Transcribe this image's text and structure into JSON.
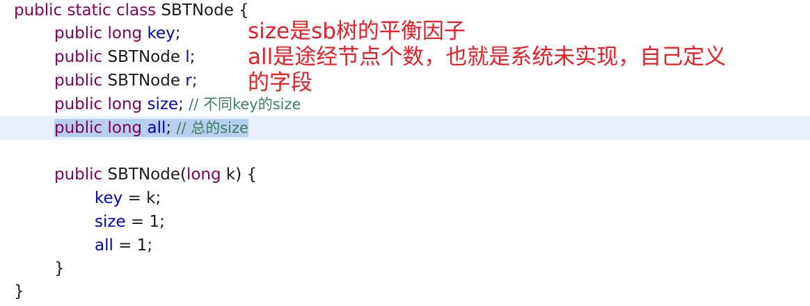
{
  "code": {
    "lines": [
      {
        "indent": 0,
        "tokens": [
          {
            "t": "public static class ",
            "c": "kw"
          },
          {
            "t": "SBTNode {",
            "c": "pl"
          }
        ]
      },
      {
        "indent": 1,
        "tokens": [
          {
            "t": "public long ",
            "c": "kw"
          },
          {
            "t": "key",
            "c": "fld"
          },
          {
            "t": ";",
            "c": "pl"
          }
        ]
      },
      {
        "indent": 1,
        "tokens": [
          {
            "t": "public ",
            "c": "kw"
          },
          {
            "t": "SBTNode ",
            "c": "pl"
          },
          {
            "t": "l",
            "c": "fld"
          },
          {
            "t": ";",
            "c": "pl"
          }
        ]
      },
      {
        "indent": 1,
        "tokens": [
          {
            "t": "public ",
            "c": "kw"
          },
          {
            "t": "SBTNode ",
            "c": "pl"
          },
          {
            "t": "r",
            "c": "fld"
          },
          {
            "t": ";",
            "c": "pl"
          }
        ]
      },
      {
        "indent": 1,
        "tokens": [
          {
            "t": "public long ",
            "c": "kw"
          },
          {
            "t": "size",
            "c": "fld"
          },
          {
            "t": "; ",
            "c": "pl"
          },
          {
            "t": "// 不同key的size",
            "c": "cm"
          }
        ]
      },
      {
        "indent": 1,
        "highlighted": true,
        "tokens": [
          {
            "t": "public long ",
            "c": "kw"
          },
          {
            "t": "all",
            "c": "fld"
          },
          {
            "t": "; ",
            "c": "pl"
          },
          {
            "t": "// 总的size",
            "c": "cm"
          }
        ]
      },
      {
        "indent": 0,
        "tokens": []
      },
      {
        "indent": 1,
        "tokens": [
          {
            "t": "public ",
            "c": "kw"
          },
          {
            "t": "SBTNode(",
            "c": "pl"
          },
          {
            "t": "long ",
            "c": "kw"
          },
          {
            "t": "k) {",
            "c": "pl"
          }
        ]
      },
      {
        "indent": 2,
        "tokens": [
          {
            "t": "key",
            "c": "fld"
          },
          {
            "t": " = k;",
            "c": "pl"
          }
        ]
      },
      {
        "indent": 2,
        "tokens": [
          {
            "t": "size",
            "c": "fld"
          },
          {
            "t": " = 1;",
            "c": "pl"
          }
        ]
      },
      {
        "indent": 2,
        "tokens": [
          {
            "t": "all",
            "c": "fld"
          },
          {
            "t": " = 1;",
            "c": "pl"
          }
        ]
      },
      {
        "indent": 1,
        "tokens": [
          {
            "t": "}",
            "c": "pl"
          }
        ]
      },
      {
        "indent": 0,
        "tokens": [
          {
            "t": "}",
            "c": "pl"
          }
        ]
      }
    ]
  },
  "annotation": {
    "lines": [
      "size是sb树的平衡因子",
      "all是途经节点个数，也就是系统未实现，自己定义",
      "的字段"
    ],
    "color": "#ee1c25"
  },
  "colors": {
    "keyword": "#7f0055",
    "field": "#0000c0",
    "comment": "#3f7f5f",
    "highlight": "#b7cff0"
  }
}
